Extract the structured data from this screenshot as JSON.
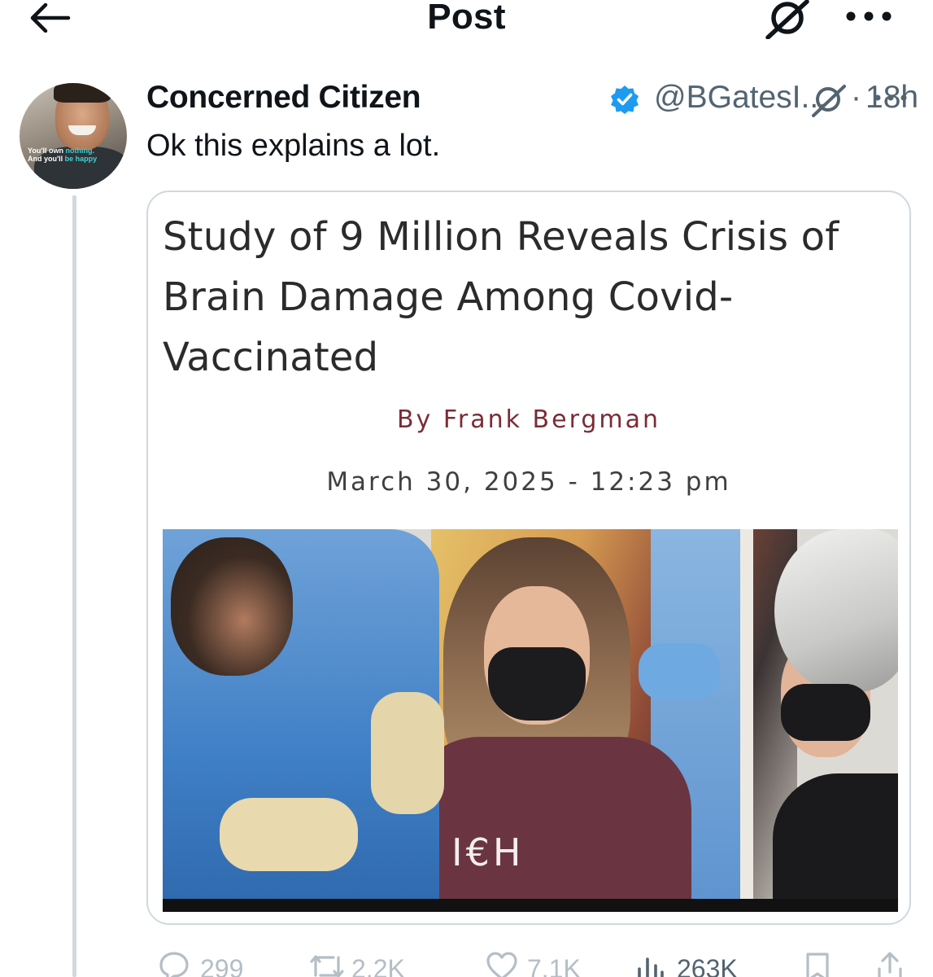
{
  "header": {
    "title": "Post",
    "back_icon": "arrow-left-icon",
    "grok_icon": "grok-icon",
    "more_icon": "more-horizontal-icon"
  },
  "post": {
    "author": {
      "display_name": "Concerned Citizen",
      "verified": true,
      "verified_color": "#1d9bf0",
      "handle": "@BGatesI...",
      "separator": "·",
      "timestamp": "18h",
      "avatar_text_line1": "You'll own",
      "avatar_text_line1_accent": "nothing.",
      "avatar_text_line2": "And you'll",
      "avatar_text_line2_accent": "be happy"
    },
    "text": "Ok this explains a lot.",
    "card": {
      "headline": "Study of 9 Million Reveals Crisis of Brain Damage Among Covid-Vaccinated",
      "byline": "By Frank Bergman",
      "dateline": "March 30, 2025 - 12:23 pm",
      "image_shirt_text": "I€H",
      "byline_color": "#7b2b36"
    },
    "stats": {
      "replies": "299",
      "reposts": "2.2K",
      "likes": "7.1K",
      "views": "263K"
    }
  },
  "colors": {
    "text_primary": "#0f1419",
    "text_secondary": "#536471",
    "border": "#cfd9de"
  }
}
